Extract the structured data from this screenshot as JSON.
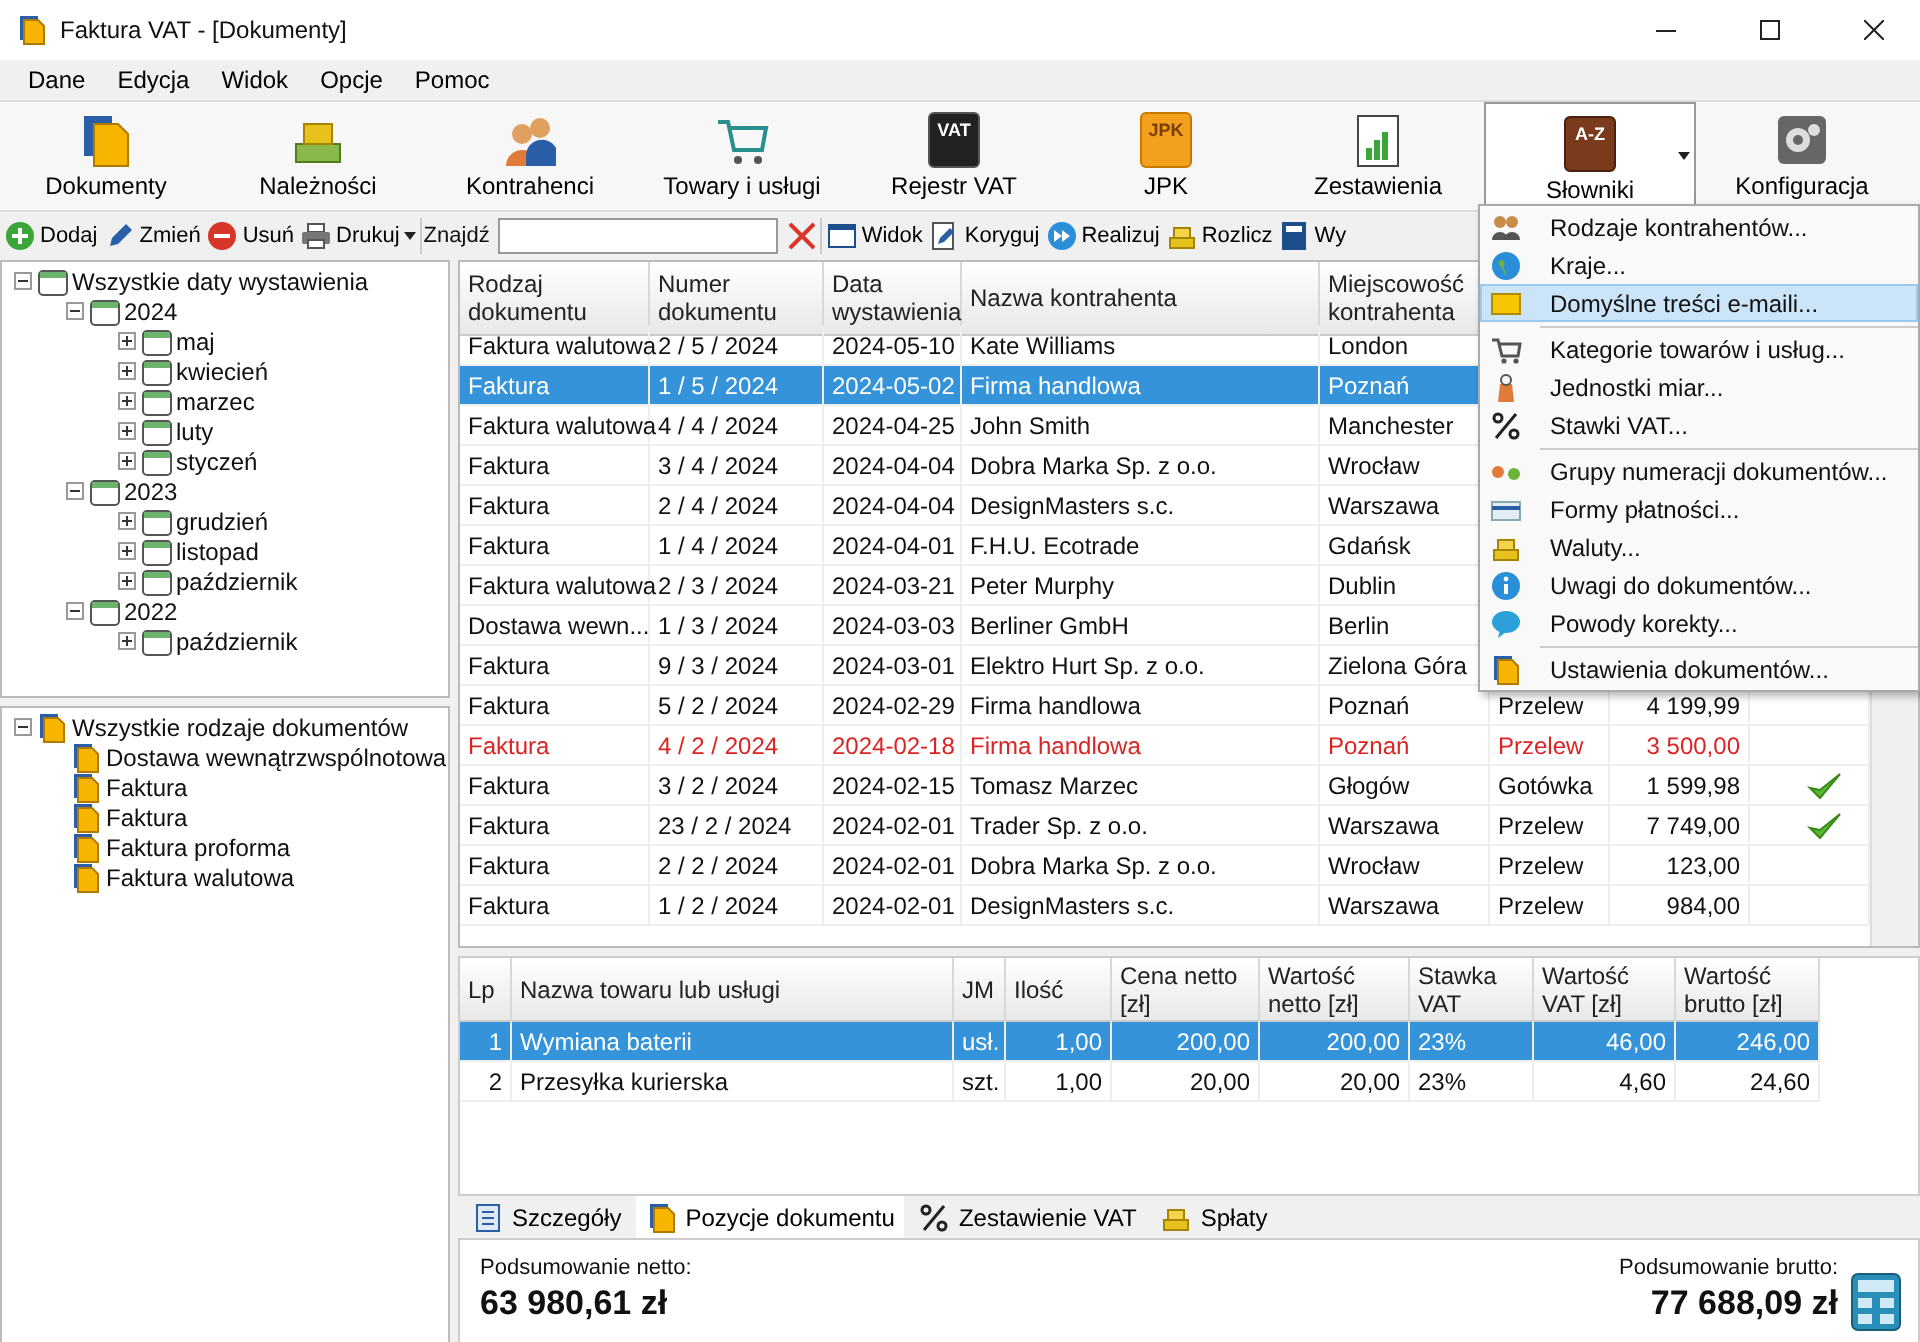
{
  "window": {
    "title": "Faktura VAT - [Dokumenty]"
  },
  "menu_bar": [
    "Dane",
    "Edycja",
    "Widok",
    "Opcje",
    "Pomoc"
  ],
  "main_toolbar": [
    {
      "label": "Dokumenty",
      "open": false
    },
    {
      "label": "Należności",
      "open": false
    },
    {
      "label": "Kontrahenci",
      "open": false
    },
    {
      "label": "Towary i usługi",
      "open": false
    },
    {
      "label": "Rejestr VAT",
      "open": false,
      "icon_text": "VAT"
    },
    {
      "label": "JPK",
      "open": false,
      "icon_text": "JPK"
    },
    {
      "label": "Zestawienia",
      "open": false
    },
    {
      "label": "Słowniki",
      "open": true,
      "icon_text": "A-Z",
      "dropdown": true
    },
    {
      "label": "Konfiguracja",
      "open": false
    }
  ],
  "action_toolbar": [
    {
      "kind": "button",
      "label": "Dodaj"
    },
    {
      "kind": "button",
      "label": "Zmień"
    },
    {
      "kind": "button",
      "label": "Usuń"
    },
    {
      "kind": "button",
      "label": "Drukuj",
      "dropdown": true
    },
    {
      "kind": "search",
      "label": "Znajdź"
    },
    {
      "kind": "button",
      "label": "Widok"
    },
    {
      "kind": "button",
      "label": "Koryguj"
    },
    {
      "kind": "button",
      "label": "Realizuj"
    },
    {
      "kind": "button",
      "label": "Rozlicz"
    },
    {
      "kind": "button",
      "label": "Wy"
    }
  ],
  "date_tree": [
    {
      "label": "Wszystkie daty wystawienia",
      "expanded": true,
      "children": [
        {
          "label": "2024",
          "expanded": true,
          "children": [
            {
              "label": "maj",
              "expanded": false
            },
            {
              "label": "kwiecień",
              "expanded": false
            },
            {
              "label": "marzec",
              "expanded": false
            },
            {
              "label": "luty",
              "expanded": false
            },
            {
              "label": "styczeń",
              "expanded": false
            }
          ]
        },
        {
          "label": "2023",
          "expanded": true,
          "children": [
            {
              "label": "grudzień",
              "expanded": false
            },
            {
              "label": "listopad",
              "expanded": false
            },
            {
              "label": "październik",
              "expanded": false
            }
          ]
        },
        {
          "label": "2022",
          "expanded": true,
          "children": [
            {
              "label": "październik",
              "expanded": false
            }
          ]
        }
      ]
    }
  ],
  "type_tree": [
    {
      "label": "Wszystkie rodzaje dokumentów",
      "expanded": true,
      "children": [
        {
          "label": "Dostawa wewnątrzwspólnotowa"
        },
        {
          "label": "Faktura"
        },
        {
          "label": "Faktura"
        },
        {
          "label": "Faktura proforma"
        },
        {
          "label": "Faktura walutowa"
        }
      ]
    }
  ],
  "documents": {
    "columns": [
      "Rodzaj dokumentu",
      "Numer dokumentu",
      "Data wystawienia",
      "Nazwa kontrahenta",
      "Miejscowość kontrahenta"
    ],
    "rows": [
      {
        "selected": false,
        "overdue": false,
        "cells": [
          "Faktura walutowa",
          "2 / 5 / 2024",
          "2024-05-10",
          "Kate Williams",
          "London"
        ]
      },
      {
        "selected": true,
        "overdue": false,
        "cells": [
          "Faktura",
          "1 / 5 / 2024",
          "2024-05-02",
          "Firma handlowa",
          "Poznań"
        ]
      },
      {
        "selected": false,
        "overdue": false,
        "cells": [
          "Faktura walutowa",
          "4 / 4 / 2024",
          "2024-04-25",
          "John Smith",
          "Manchester"
        ]
      },
      {
        "selected": false,
        "overdue": false,
        "cells": [
          "Faktura",
          "3 / 4 / 2024",
          "2024-04-04",
          "Dobra Marka Sp. z o.o.",
          "Wrocław"
        ]
      },
      {
        "selected": false,
        "overdue": false,
        "cells": [
          "Faktura",
          "2 / 4 / 2024",
          "2024-04-04",
          "DesignMasters s.c.",
          "Warszawa"
        ]
      },
      {
        "selected": false,
        "overdue": false,
        "cells": [
          "Faktura",
          "1 / 4 / 2024",
          "2024-04-01",
          "F.H.U. Ecotrade",
          "Gdańsk"
        ]
      },
      {
        "selected": false,
        "overdue": false,
        "cells": [
          "Faktura walutowa",
          "2 / 3 / 2024",
          "2024-03-21",
          "Peter Murphy",
          "Dublin"
        ]
      },
      {
        "selected": false,
        "overdue": false,
        "cells": [
          "Dostawa wewn...",
          "1 / 3 / 2024",
          "2024-03-03",
          "Berliner GmbH",
          "Berlin"
        ]
      },
      {
        "selected": false,
        "overdue": false,
        "cells": [
          "Faktura",
          "9 / 3 / 2024",
          "2024-03-01",
          "Elektro Hurt Sp. z o.o.",
          "Zielona Góra"
        ]
      },
      {
        "selected": false,
        "overdue": false,
        "cells": [
          "Faktura",
          "5 / 2 / 2024",
          "2024-02-29",
          "Firma handlowa",
          "Poznań"
        ],
        "payment": "Przelew",
        "amount": "4 199,99",
        "paid": false
      },
      {
        "selected": false,
        "overdue": true,
        "cells": [
          "Faktura",
          "4 / 2 / 2024",
          "2024-02-18",
          "Firma handlowa",
          "Poznań"
        ],
        "payment": "Przelew",
        "amount": "3 500,00",
        "paid": false
      },
      {
        "selected": false,
        "overdue": false,
        "cells": [
          "Faktura",
          "3 / 2 / 2024",
          "2024-02-15",
          "Tomasz Marzec",
          "Głogów"
        ],
        "payment": "Gotówka",
        "amount": "1 599,98",
        "paid": true
      },
      {
        "selected": false,
        "overdue": false,
        "cells": [
          "Faktura",
          "23 / 2 / 2024",
          "2024-02-01",
          "Trader Sp. z o.o.",
          "Warszawa"
        ],
        "payment": "Przelew",
        "amount": "7 749,00",
        "paid": true
      },
      {
        "selected": false,
        "overdue": false,
        "cells": [
          "Faktura",
          "2 / 2 / 2024",
          "2024-02-01",
          "Dobra Marka Sp. z o.o.",
          "Wrocław"
        ],
        "payment": "Przelew",
        "amount": "123,00",
        "paid": false
      },
      {
        "selected": false,
        "overdue": false,
        "cells": [
          "Faktura",
          "1 / 2 / 2024",
          "2024-02-01",
          "DesignMasters s.c.",
          "Warszawa"
        ],
        "payment": "Przelew",
        "amount": "984,00",
        "paid": false
      }
    ]
  },
  "items": {
    "columns": [
      "Lp",
      "Nazwa towaru lub usługi",
      "JM",
      "Ilość",
      "Cena netto\n[zł]",
      "Wartość\nnetto [zł]",
      "Stawka\nVAT",
      "Wartość\nVAT [zł]",
      "Wartość\nbrutto [zł]"
    ],
    "rows": [
      {
        "selected": true,
        "cells": [
          "1",
          "Wymiana baterii",
          "usł.",
          "1,00",
          "200,00",
          "200,00",
          "23%",
          "46,00",
          "246,00"
        ]
      },
      {
        "selected": false,
        "cells": [
          "2",
          "Przesyłka kurierska",
          "szt.",
          "1,00",
          "20,00",
          "20,00",
          "23%",
          "4,60",
          "24,60"
        ]
      }
    ]
  },
  "detail_tabs": [
    {
      "label": "Szczegóły",
      "selected": false
    },
    {
      "label": "Pozycje dokumentu",
      "selected": true
    },
    {
      "label": "Zestawienie VAT",
      "selected": false
    },
    {
      "label": "Spłaty",
      "selected": false
    }
  ],
  "summary": {
    "net_label": "Podsumowanie netto:",
    "net_value": "63 980,61 zł",
    "gross_label": "Podsumowanie brutto:",
    "gross_value": "77 688,09 zł"
  },
  "dictionary_menu": [
    [
      {
        "label": "Rodzaje kontrahentów...",
        "selected": false
      },
      {
        "label": "Kraje...",
        "selected": false
      },
      {
        "label": "Domyślne treści e-maili...",
        "selected": true
      }
    ],
    [
      {
        "label": "Kategorie towarów i usług...",
        "selected": false
      },
      {
        "label": "Jednostki miar...",
        "selected": false
      },
      {
        "label": "Stawki VAT...",
        "selected": false
      }
    ],
    [
      {
        "label": "Grupy numeracji dokumentów...",
        "selected": false
      },
      {
        "label": "Formy płatności...",
        "selected": false
      },
      {
        "label": "Waluty...",
        "selected": false
      },
      {
        "label": "Uwagi do dokumentów...",
        "selected": false
      },
      {
        "label": "Powody korekty...",
        "selected": false
      }
    ],
    [
      {
        "label": "Ustawienia dokumentów...",
        "selected": false
      }
    ]
  ]
}
